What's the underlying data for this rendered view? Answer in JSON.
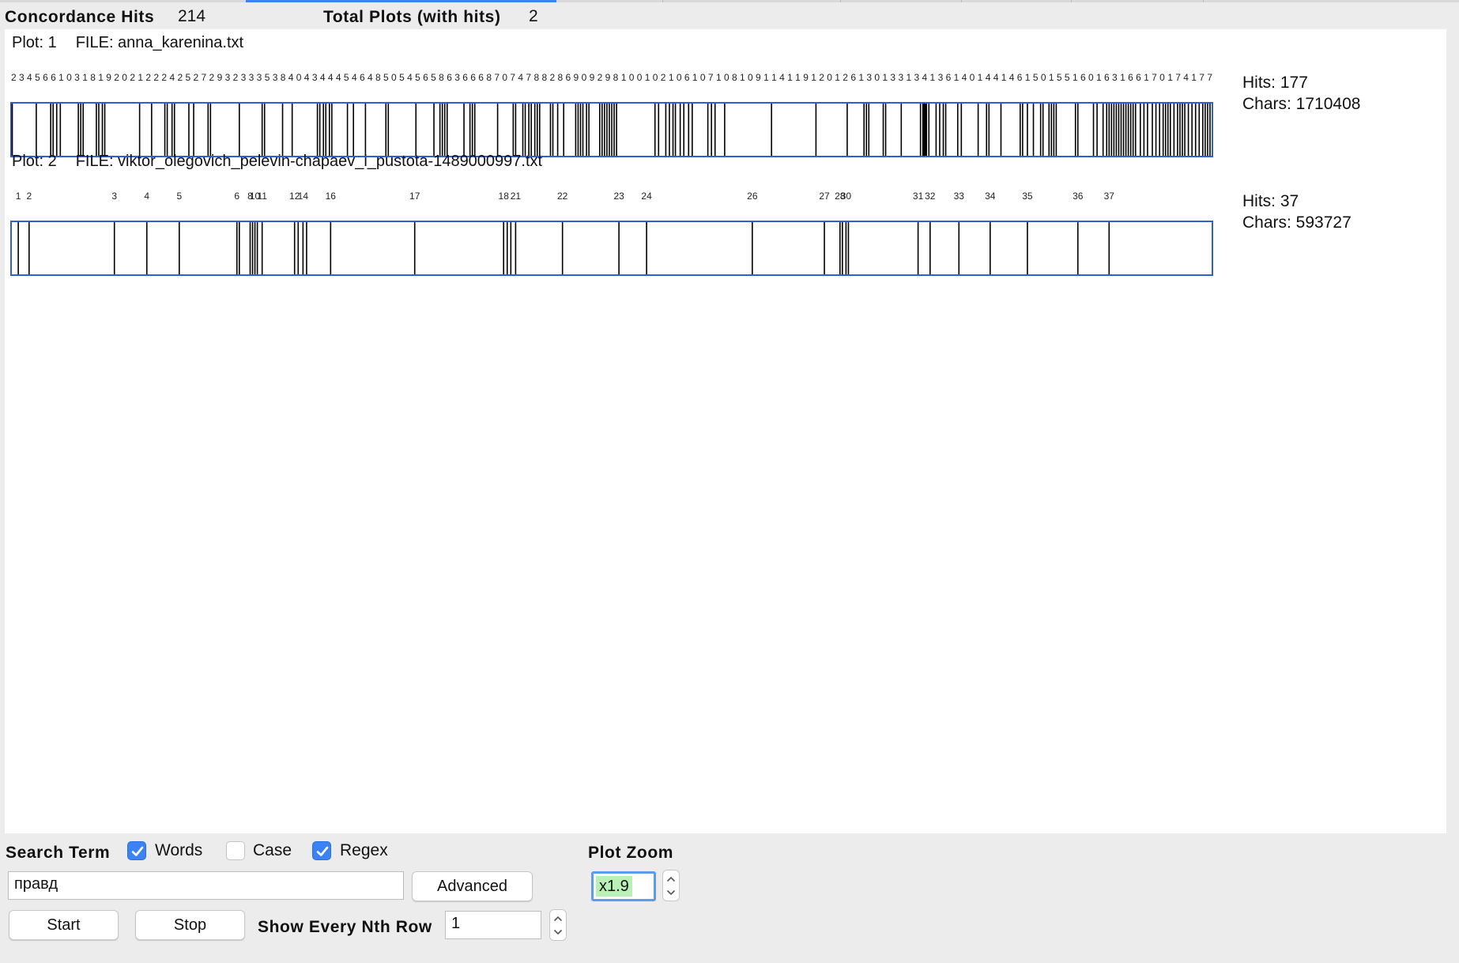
{
  "header": {
    "concordance_hits_label": "Concordance Hits",
    "concordance_hits_value": "214",
    "total_plots_label": "Total Plots (with hits)",
    "total_plots_value": "2"
  },
  "plots": [
    {
      "plot_label": "Plot: 1",
      "file_label": "FILE: anna_karenina.txt",
      "hits_label": "Hits: 177",
      "chars_label": "Chars: 1710408",
      "tick_labels": "2   3  4 5 6 6   1 0 3 1 8 1 9   2 0  2 1 2 2 2 4  2 5 2 7 2 9  3 2 3 3  3 5   3 8 4 0 4 3 4 4  4 5 4 6 4 8  5 0  5 4 5 6  5 8 6 3  6 6 6 8  7 0 7 4  7 8 8 2 8 6 9 0 9 2   9 8 1 0 0 1 0 2 1 0 6   1 0 7   1 0 8   1 0 9 1 1 4  1 1 9 1 2 0  1 2 6 1 3 0  1 3 3 1 3 4 1 3 6 1 4 0 1 4 4 1 4 6   1 5 0 1 5 5 1 6 0 1 6 3 1 6 6 1 7 0 1 7 4 1 7 7",
      "hit_positions": [
        0.001,
        0.021,
        0.033,
        0.035,
        0.038,
        0.041,
        0.056,
        0.058,
        0.06,
        0.071,
        0.073,
        0.076,
        0.078,
        0.107,
        0.117,
        0.128,
        0.13,
        0.134,
        0.136,
        0.148,
        0.152,
        0.164,
        0.166,
        0.19,
        0.209,
        0.211,
        0.226,
        0.234,
        0.255,
        0.257,
        0.26,
        0.262,
        0.265,
        0.267,
        0.28,
        0.285,
        0.295,
        0.312,
        0.314,
        0.337,
        0.352,
        0.357,
        0.359,
        0.361,
        0.363,
        0.377,
        0.382,
        0.384,
        0.386,
        0.405,
        0.418,
        0.42,
        0.426,
        0.428,
        0.431,
        0.433,
        0.436,
        0.438,
        0.44,
        0.449,
        0.451,
        0.455,
        0.46,
        0.47,
        0.472,
        0.474,
        0.476,
        0.479,
        0.481,
        0.49,
        0.492,
        0.494,
        0.496,
        0.498,
        0.5,
        0.502,
        0.504,
        0.536,
        0.539,
        0.545,
        0.548,
        0.551,
        0.553,
        0.557,
        0.56,
        0.564,
        0.567,
        0.58,
        0.583,
        0.586,
        0.594,
        0.633,
        0.67,
        0.696,
        0.71,
        0.712,
        0.714,
        0.726,
        0.728,
        0.741,
        0.757,
        0.759,
        0.76,
        0.761,
        0.762,
        0.764,
        0.77,
        0.773,
        0.776,
        0.778,
        0.788,
        0.791,
        0.805,
        0.812,
        0.814,
        0.824,
        0.84,
        0.842,
        0.846,
        0.851,
        0.857,
        0.859,
        0.864,
        0.866,
        0.868,
        0.87,
        0.886,
        0.888,
        0.901,
        0.904,
        0.909,
        0.912,
        0.914,
        0.916,
        0.918,
        0.92,
        0.922,
        0.924,
        0.926,
        0.928,
        0.93,
        0.932,
        0.934,
        0.936,
        0.94,
        0.943,
        0.946,
        0.95,
        0.953,
        0.956,
        0.959,
        0.961,
        0.963,
        0.965,
        0.968,
        0.971,
        0.973,
        0.975,
        0.977,
        0.98,
        0.983,
        0.986,
        0.989,
        0.992,
        0.994,
        0.996,
        0.998
      ]
    },
    {
      "plot_label": "Plot: 2",
      "file_label": "FILE: viktor_olegovich_pelevin-chapaev_i_pustota-1489000997.txt",
      "hits_label": "Hits: 37",
      "chars_label": "Chars: 593727",
      "tick_labels": [
        {
          "t": "1",
          "p": 0.006
        },
        {
          "t": "2",
          "p": 0.015
        },
        {
          "t": "3",
          "p": 0.086
        },
        {
          "t": "4",
          "p": 0.113
        },
        {
          "t": "5",
          "p": 0.14
        },
        {
          "t": "6",
          "p": 0.188
        },
        {
          "t": "8",
          "p": 0.199
        },
        {
          "t": "10",
          "p": 0.203
        },
        {
          "t": "11",
          "p": 0.209
        },
        {
          "t": "12",
          "p": 0.236
        },
        {
          "t": "14",
          "p": 0.243
        },
        {
          "t": "16",
          "p": 0.266
        },
        {
          "t": "17",
          "p": 0.336
        },
        {
          "t": "18",
          "p": 0.41
        },
        {
          "t": "21",
          "p": 0.42
        },
        {
          "t": "22",
          "p": 0.459
        },
        {
          "t": "23",
          "p": 0.506
        },
        {
          "t": "24",
          "p": 0.529
        },
        {
          "t": "26",
          "p": 0.617
        },
        {
          "t": "27",
          "p": 0.677
        },
        {
          "t": "28",
          "p": 0.69
        },
        {
          "t": "30",
          "p": 0.695
        },
        {
          "t": "31",
          "p": 0.755
        },
        {
          "t": "32",
          "p": 0.765
        },
        {
          "t": "33",
          "p": 0.789
        },
        {
          "t": "34",
          "p": 0.815
        },
        {
          "t": "35",
          "p": 0.846
        },
        {
          "t": "36",
          "p": 0.888
        },
        {
          "t": "37",
          "p": 0.914
        }
      ],
      "hit_positions": [
        0.006,
        0.015,
        0.086,
        0.113,
        0.14,
        0.188,
        0.19,
        0.199,
        0.201,
        0.203,
        0.205,
        0.209,
        0.236,
        0.239,
        0.243,
        0.246,
        0.266,
        0.336,
        0.41,
        0.413,
        0.416,
        0.42,
        0.459,
        0.506,
        0.529,
        0.617,
        0.677,
        0.69,
        0.692,
        0.695,
        0.697,
        0.755,
        0.765,
        0.789,
        0.815,
        0.846,
        0.888,
        0.914
      ]
    }
  ],
  "controls": {
    "search_term_label": "Search Term",
    "words_label": "Words",
    "words_checked": true,
    "case_label": "Case",
    "case_checked": false,
    "regex_label": "Regex",
    "regex_checked": true,
    "search_value": "правд",
    "advanced_label": "Advanced",
    "start_label": "Start",
    "stop_label": "Stop",
    "nth_row_label": "Show Every Nth Row",
    "nth_row_value": "1",
    "plot_zoom_label": "Plot Zoom",
    "plot_zoom_value": "x1.9"
  },
  "colors": {
    "accent": "#3b82f6",
    "plot_border": "#2f5fd6",
    "hit_line": "#000000",
    "zoom_highlight": "#b9f0b5"
  }
}
